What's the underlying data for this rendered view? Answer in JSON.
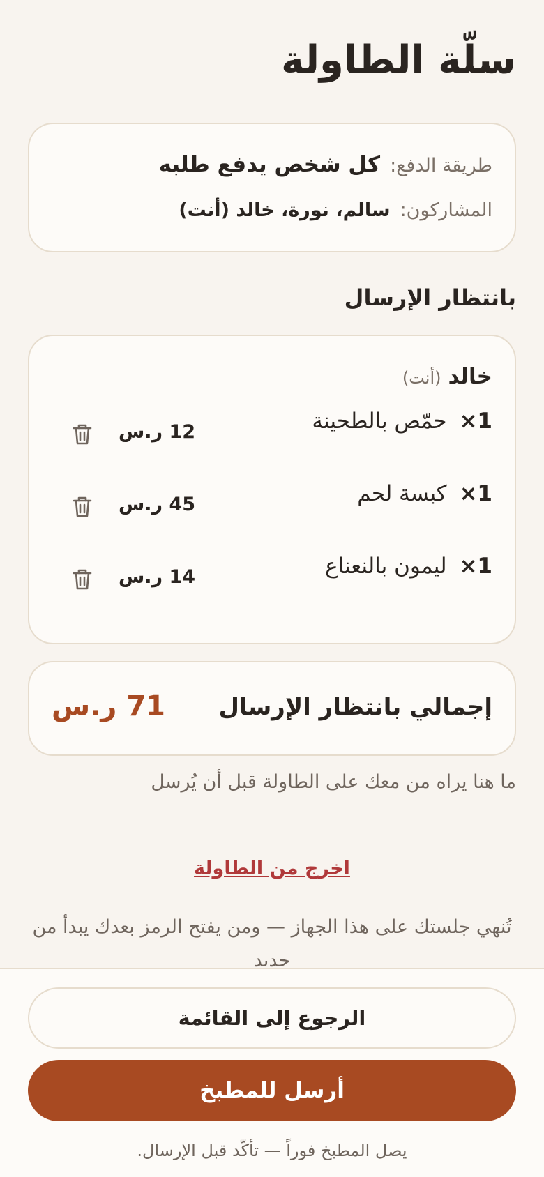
{
  "page": {
    "title": "سلّة الطاولة"
  },
  "info": {
    "payment_label": "طريقة الدفع:",
    "payment_value": "كل شخص يدفع طلبه",
    "participants_label": "المشاركون:",
    "participants_value": "سالم، نورة، خالد (أنت)"
  },
  "pending": {
    "section_title": "بانتظار الإرسال",
    "person_name": "خالد",
    "person_tag": "(أنت)",
    "items": [
      {
        "qty": "1×",
        "name": "حمّص بالطحينة",
        "price": "12 ر.س"
      },
      {
        "qty": "1×",
        "name": "كبسة لحم",
        "price": "45 ر.س"
      },
      {
        "qty": "1×",
        "name": "ليمون بالنعناع",
        "price": "14 ر.س"
      }
    ]
  },
  "total": {
    "label": "إجمالي بانتظار الإرسال",
    "value": "71 ر.س"
  },
  "hint": "ما هنا يراه من معك على الطاولة قبل أن يُرسل",
  "leave": {
    "link": "اخرج من الطاولة",
    "note": "تُنهي جلستك على هذا الجهاز — ومن يفتح الرمز بعدك يبدأ من جديد"
  },
  "actions": {
    "back_label": "الرجوع إلى القائمة",
    "send_label": "أرسل للمطبخ",
    "send_note": "يصل المطبخ فوراً — تأكّد قبل الإرسال."
  },
  "colors": {
    "accent": "#a84a22",
    "danger_link": "#b0393a",
    "background": "#f8f4ef",
    "border": "#e6dccd"
  },
  "icons": {
    "delete": "trash-icon"
  }
}
